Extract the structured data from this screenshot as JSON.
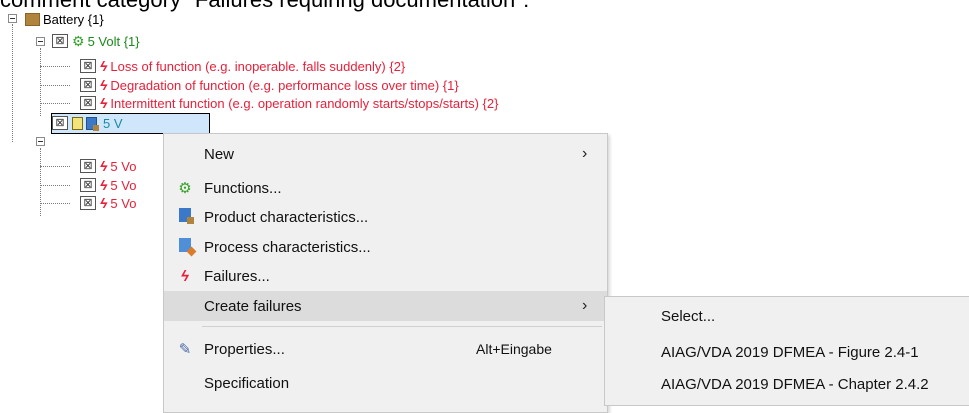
{
  "heading": "comment category \"Failures requiring documentation\":",
  "tree": {
    "root": "Battery {1}",
    "function_node": "5 Volt {1}",
    "failures": [
      "Loss of function (e.g. inoperable. falls suddenly) {2}",
      "Degradation of function (e.g. performance loss over time) {1}",
      "Intermittent function (e.g. operation randomly starts/stops/starts) {2}"
    ],
    "selected_node": "5 V",
    "child_failures": [
      "5 Vo",
      "5 Vo",
      "5 Vo"
    ]
  },
  "context_menu": {
    "items": [
      {
        "label": "New",
        "icon": "",
        "submenu": true
      },
      {
        "label": "Functions...",
        "icon": "functions-icon"
      },
      {
        "label": "Product characteristics...",
        "icon": "product-characteristics-icon"
      },
      {
        "label": "Process characteristics...",
        "icon": "process-characteristics-icon"
      },
      {
        "label": "Failures...",
        "icon": "failure-bolt-icon"
      },
      {
        "label": "Create failures",
        "icon": "",
        "submenu": true
      },
      {
        "label": "Properties...",
        "icon": "pencil-icon",
        "shortcut": "Alt+Eingabe"
      },
      {
        "label": "Specification",
        "icon": ""
      }
    ]
  },
  "submenu": {
    "items": [
      "Select...",
      "AIAG/VDA 2019 DFMEA - Figure 2.4-1",
      "AIAG/VDA 2019 DFMEA - Chapter 2.4.2"
    ]
  },
  "colors": {
    "failure_red": "#e8203a",
    "function_green": "#1a8a1a",
    "selection_teal": "#1a8aa0",
    "menu_bg": "#f0f0f0",
    "hover_bg": "#dcdcdc"
  }
}
